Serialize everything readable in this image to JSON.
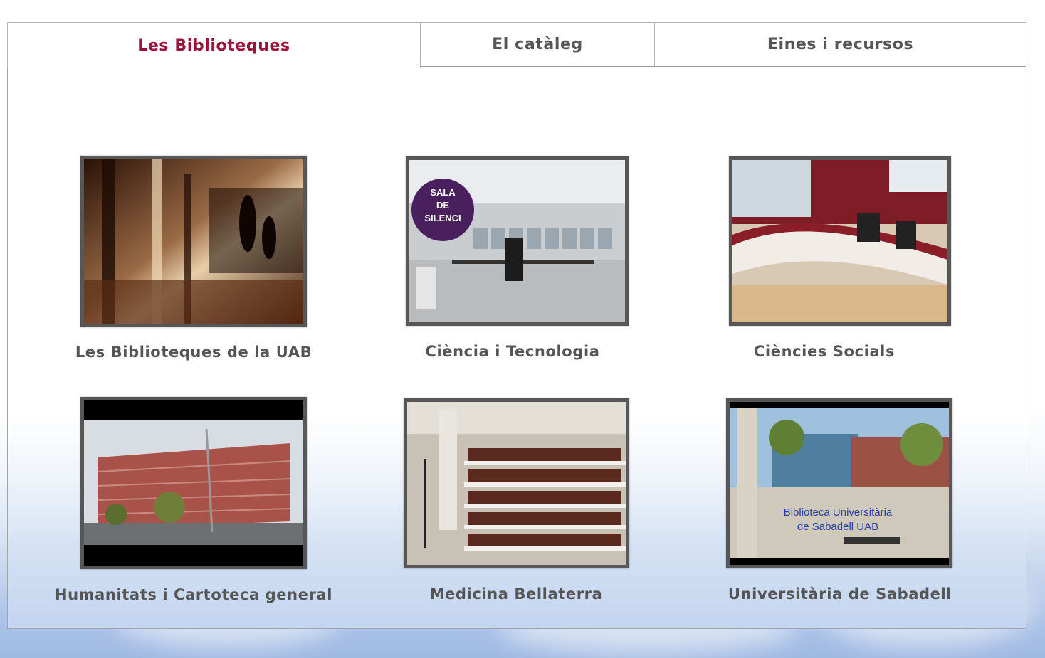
{
  "tabs": [
    {
      "label": "Les Biblioteques",
      "active": true
    },
    {
      "label": "El catàleg",
      "active": false
    },
    {
      "label": "Eines i recursos",
      "active": false
    }
  ],
  "libraries": [
    {
      "caption": "Les Biblioteques de la UAB"
    },
    {
      "caption": "Ciència i Tecnologia",
      "sign_lines": [
        "SALA",
        "DE",
        "SILENCI"
      ]
    },
    {
      "caption": "Ciències Socials"
    },
    {
      "caption": "Humanitats i Cartoteca general"
    },
    {
      "caption": "Medicina Bellaterra"
    },
    {
      "caption": "Universitària de Sabadell",
      "overlay_lines": [
        "Biblioteca Universitària",
        "de Sabadell UAB"
      ]
    }
  ],
  "colors": {
    "active_tab": "#9b1238",
    "text": "#555555",
    "frame": "#575757"
  }
}
